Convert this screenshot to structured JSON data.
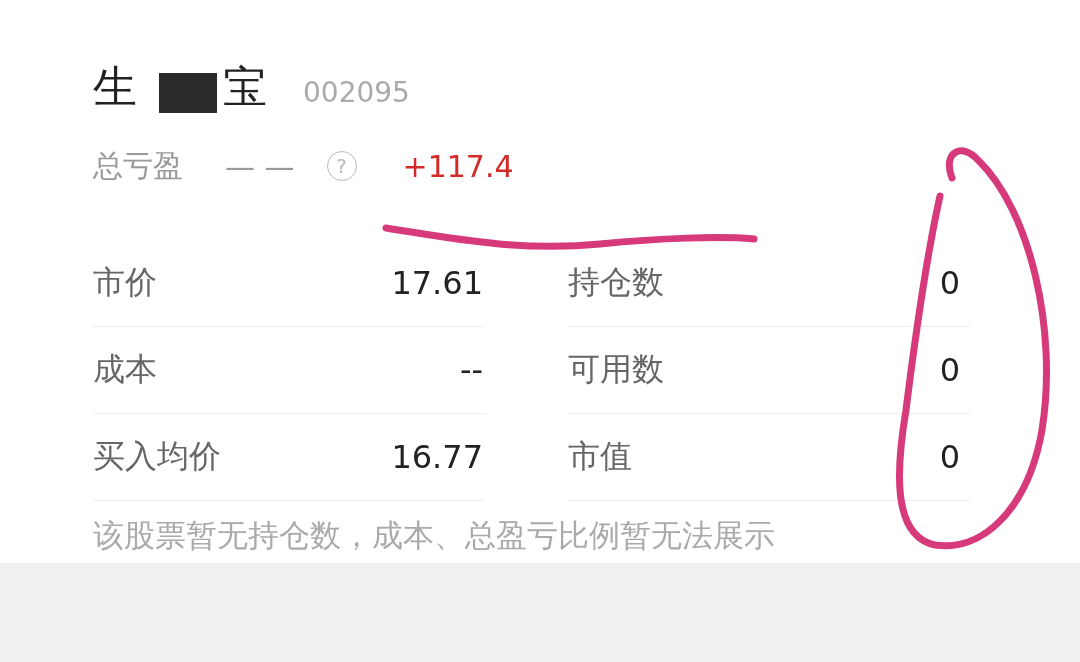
{
  "stock": {
    "name_parts": [
      "生",
      "宝"
    ],
    "code": "002095"
  },
  "summary": {
    "label": "总亏盈",
    "dashes": "— —",
    "help": "?",
    "value": "+117.4"
  },
  "left_rows": [
    {
      "label": "市价",
      "value": "17.61"
    },
    {
      "label": "成本",
      "value": "--"
    },
    {
      "label": "买入均价",
      "value": "16.77"
    }
  ],
  "right_rows": [
    {
      "label": "持仓数",
      "value": "0"
    },
    {
      "label": "可用数",
      "value": "0"
    },
    {
      "label": "市值",
      "value": "0"
    }
  ],
  "note": "该股票暂无持仓数，成本、总盈亏比例暂无法展示"
}
